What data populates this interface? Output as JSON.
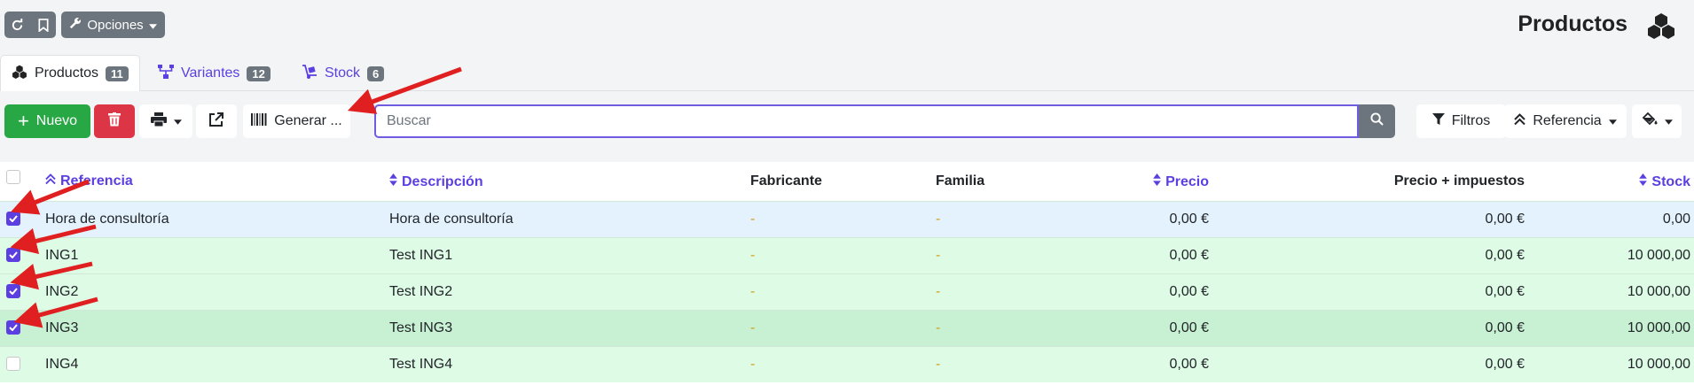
{
  "header": {
    "options_label": "Opciones",
    "page_title": "Productos",
    "reload_icon": "reload-icon",
    "bookmark_icon": "bookmark-icon",
    "wrench_icon": "wrench-icon",
    "title_icon": "cubes-icon"
  },
  "tabs": [
    {
      "label": "Productos",
      "count": "11",
      "icon": "cubes-icon",
      "active": true
    },
    {
      "label": "Variantes",
      "count": "12",
      "icon": "sitemap-icon",
      "active": false
    },
    {
      "label": "Stock",
      "count": "6",
      "icon": "dolly-icon",
      "active": false
    }
  ],
  "toolbar": {
    "new_label": "Nuevo",
    "generate_label": "Generar ...",
    "search_placeholder": "Buscar",
    "filters_label": "Filtros",
    "sort_label": "Referencia",
    "colors": {
      "new": "#28a745",
      "delete": "#dc3545",
      "accent": "#5b3fe0"
    }
  },
  "table": {
    "columns": [
      "Referencia",
      "Descripción",
      "Fabricante",
      "Familia",
      "Precio",
      "Precio + impuestos",
      "Stock"
    ],
    "rows": [
      {
        "checked": true,
        "referencia": "Hora de consultoría",
        "descripcion": "Hora de consultoría",
        "fabricante": "-",
        "familia": "-",
        "precio": "0,00 €",
        "precio_imp": "0,00 €",
        "stock": "0,00",
        "bg": "#e3f2fd"
      },
      {
        "checked": true,
        "referencia": "ING1",
        "descripcion": "Test ING1",
        "fabricante": "-",
        "familia": "-",
        "precio": "0,00 €",
        "precio_imp": "0,00 €",
        "stock": "10 000,00",
        "bg": "#defbe6"
      },
      {
        "checked": true,
        "referencia": "ING2",
        "descripcion": "Test ING2",
        "fabricante": "-",
        "familia": "-",
        "precio": "0,00 €",
        "precio_imp": "0,00 €",
        "stock": "10 000,00",
        "bg": "#defbe6"
      },
      {
        "checked": true,
        "referencia": "ING3",
        "descripcion": "Test ING3",
        "fabricante": "-",
        "familia": "-",
        "precio": "0,00 €",
        "precio_imp": "0,00 €",
        "stock": "10 000,00",
        "bg": "#c8f0d3"
      },
      {
        "checked": false,
        "referencia": "ING4",
        "descripcion": "Test ING4",
        "fabricante": "-",
        "familia": "-",
        "precio": "0,00 €",
        "precio_imp": "0,00 €",
        "stock": "10 000,00",
        "bg": "#defbe6"
      }
    ]
  },
  "annotation_color": "#e02020"
}
